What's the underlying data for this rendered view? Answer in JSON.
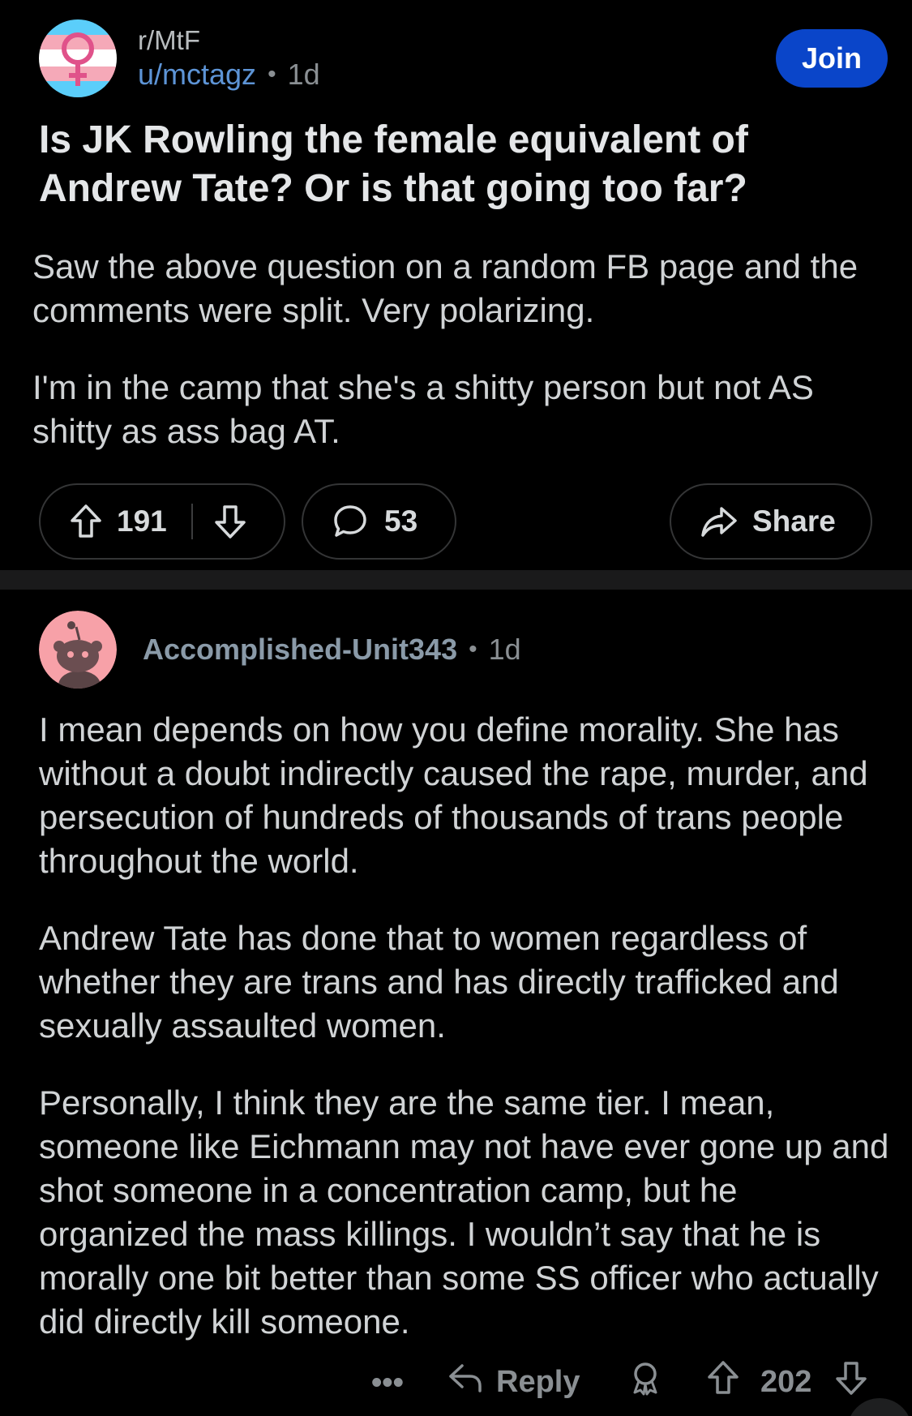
{
  "post": {
    "subreddit": "r/MtF",
    "author": "u/mctagz",
    "separator": "•",
    "age": "1d",
    "join_label": "Join",
    "title": "Is JK Rowling the female equivalent of Andrew Tate? Or is that going too far?",
    "body": [
      "Saw the above question on a random FB page and the comments were split. Very polarizing.",
      "I'm in the camp that she's a shitty person but not AS shitty as ass bag AT."
    ],
    "upvotes": "191",
    "comments": "53",
    "share_label": "Share"
  },
  "comment": {
    "author": "Accomplished-Unit343",
    "separator": "•",
    "age": "1d",
    "body": [
      "I mean depends on how you define morality. She has without a doubt indirectly caused the rape, murder, and persecution of hundreds of thousands of trans people throughout the world.",
      "Andrew Tate has done that to women regardless of whether they are trans and has directly trafficked and sexually assaulted women.",
      "Personally, I think they are the same tier. I mean, someone like Eichmann may not have ever gone up and shot someone in a concentration camp, but he organized the mass killings. I wouldn’t say that he is morally one bit better than some SS officer who actually did directly kill someone."
    ],
    "more_label": "•••",
    "reply_label": "Reply",
    "votes": "202"
  },
  "icons": {
    "subreddit": "trans-flag-venus-icon",
    "upvote": "arrow-up-icon",
    "downvote": "arrow-down-icon",
    "comment": "speech-bubble-icon",
    "share": "share-arrow-icon",
    "reply": "reply-arrow-icon",
    "award": "award-icon",
    "avatar": "snoo-avatar-icon"
  },
  "colors": {
    "background": "#000000",
    "accent": "#0a45c9",
    "author_link": "#5d94d6",
    "trans_blue": "#5bcefa",
    "trans_pink": "#f5a9b8",
    "avatar_pink": "#f7a1a8"
  }
}
